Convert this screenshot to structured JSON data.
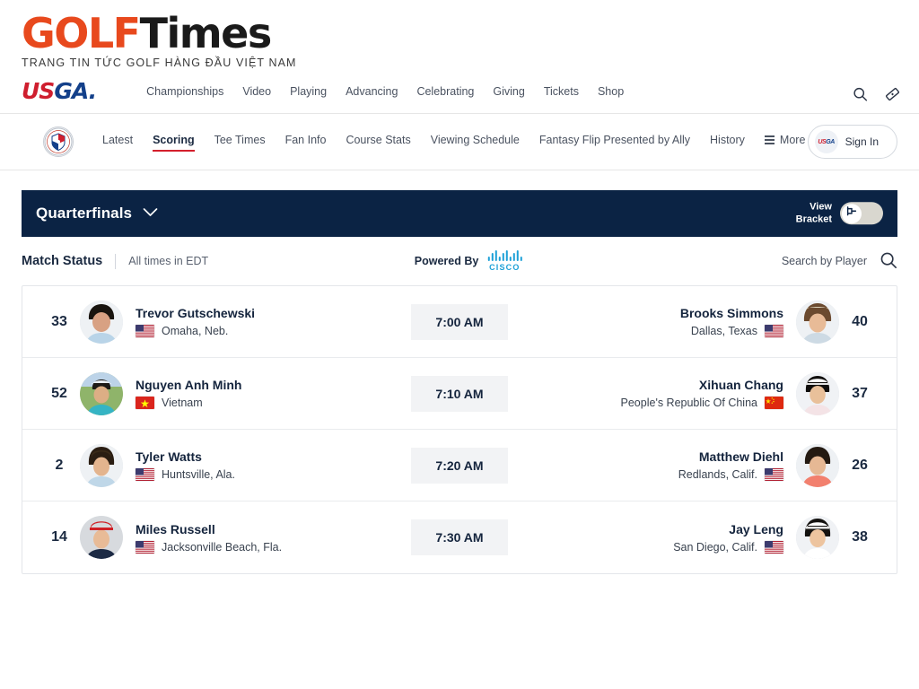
{
  "masthead": {
    "logo_golf": "GOLF",
    "logo_times": "Times",
    "tagline": "TRANG TIN TỨC GOLF HÀNG ĐẦU VIỆT NAM"
  },
  "header": {
    "usga_us": "US",
    "usga_ga": "GA",
    "usga_dot": ".",
    "nav": [
      {
        "label": "Championships"
      },
      {
        "label": "Video"
      },
      {
        "label": "Playing"
      },
      {
        "label": "Advancing"
      },
      {
        "label": "Celebrating"
      },
      {
        "label": "Giving"
      },
      {
        "label": "Tickets"
      },
      {
        "label": "Shop"
      }
    ],
    "icons": [
      "search-icon",
      "ticket-icon"
    ]
  },
  "subnav": {
    "items": [
      {
        "label": "Latest",
        "active": false
      },
      {
        "label": "Scoring",
        "active": true
      },
      {
        "label": "Tee Times",
        "active": false
      },
      {
        "label": "Fan Info",
        "active": false
      },
      {
        "label": "Course Stats",
        "active": false
      },
      {
        "label": "Viewing Schedule",
        "active": false
      },
      {
        "label": "Fantasy Flip Presented by Ally",
        "active": false
      },
      {
        "label": "History",
        "active": false
      }
    ],
    "more_label": "More",
    "signin_label": "Sign In",
    "signin_badge_text": "USGA"
  },
  "banner": {
    "title": "Quarterfinals",
    "bracket_line1": "View",
    "bracket_line2": "Bracket",
    "accent_navy": "#0b2344"
  },
  "status": {
    "match_status": "Match Status",
    "times_note": "All times in EDT",
    "powered_by": "Powered By",
    "cisco_word": "CISCO",
    "cisco_color": "#1ba0d7",
    "search_label": "Search by Player"
  },
  "matches": [
    {
      "left_seed": "33",
      "left_name": "Trevor Gutschewski",
      "left_location": "Omaha, Neb.",
      "left_flag": "us-flag",
      "time": "7:00 AM",
      "right_name": "Brooks Simmons",
      "right_location": "Dallas, Texas",
      "right_flag": "us-flag",
      "right_seed": "40"
    },
    {
      "left_seed": "52",
      "left_name": "Nguyen Anh Minh",
      "left_location": "Vietnam",
      "left_flag": "vn-flag",
      "time": "7:10 AM",
      "right_name": "Xihuan Chang",
      "right_location": "People's Republic Of China",
      "right_flag": "cn-flag",
      "right_seed": "37"
    },
    {
      "left_seed": "2",
      "left_name": "Tyler Watts",
      "left_location": "Huntsville, Ala.",
      "left_flag": "us-flag",
      "time": "7:20 AM",
      "right_name": "Matthew Diehl",
      "right_location": "Redlands, Calif.",
      "right_flag": "us-flag",
      "right_seed": "26"
    },
    {
      "left_seed": "14",
      "left_name": "Miles Russell",
      "left_location": "Jacksonville Beach, Fla.",
      "left_flag": "us-flag",
      "time": "7:30 AM",
      "right_name": "Jay Leng",
      "right_location": "San Diego, Calif.",
      "right_flag": "us-flag",
      "right_seed": "38"
    }
  ]
}
